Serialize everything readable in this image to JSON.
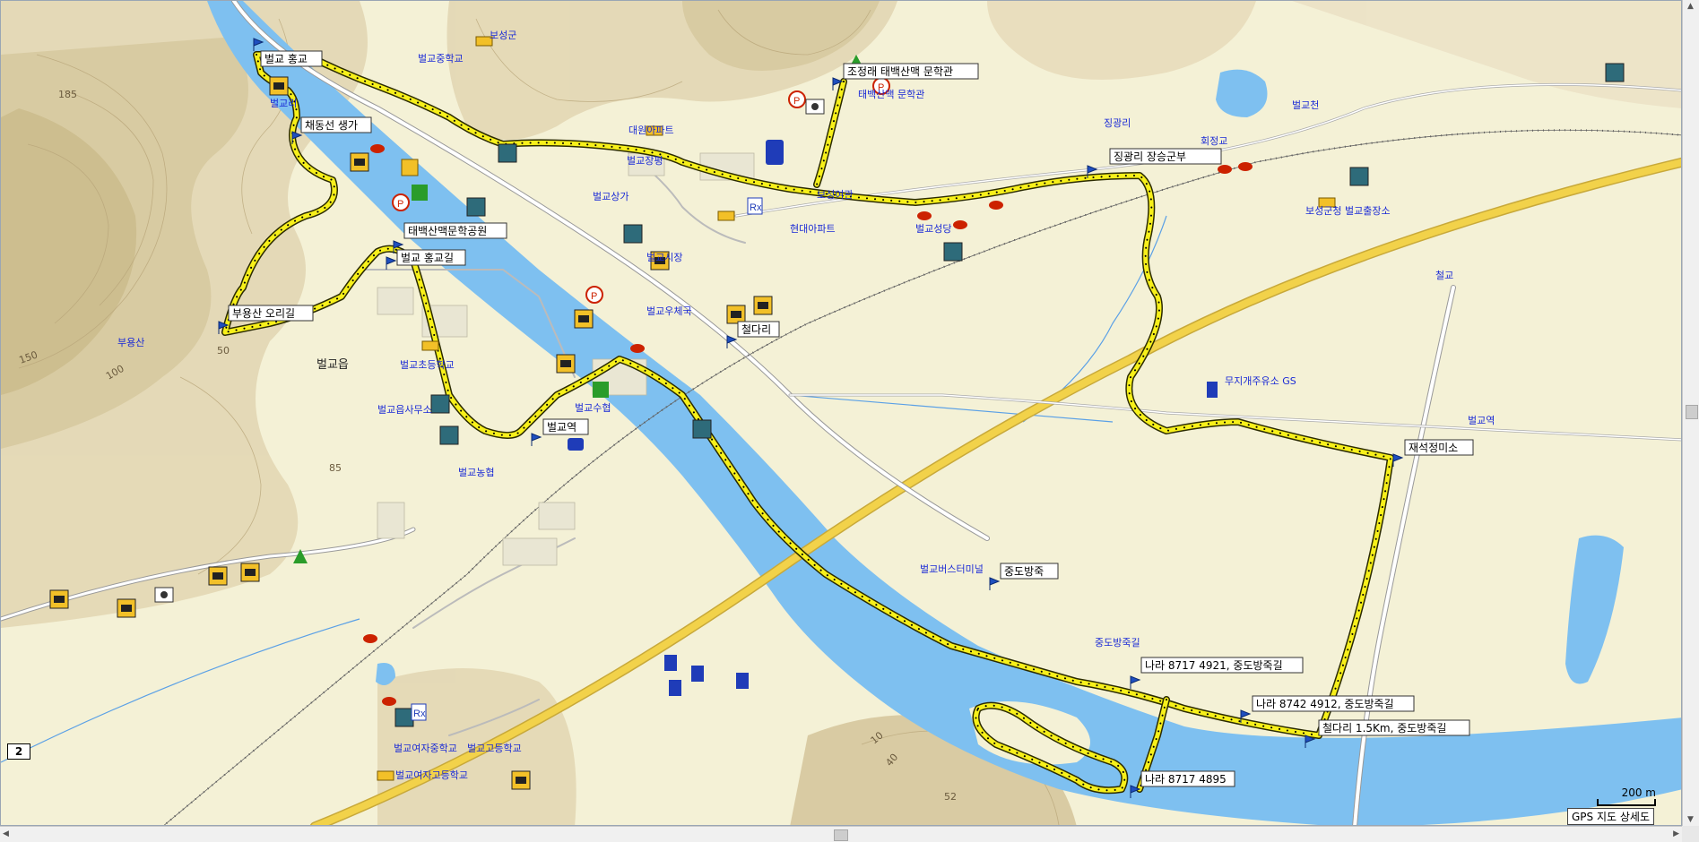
{
  "map": {
    "town_name": "벌교읍",
    "scale_label": "200 m",
    "source_label": "GPS 지도 상세도",
    "route_number": "2",
    "colors": {
      "land": "#f4f1d6",
      "hill": "#e3d7b4",
      "water": "#7ec0f0",
      "road": "#f2d24a",
      "track": "#f7f01a",
      "rail": "#555555",
      "label": "#1a2ad6"
    },
    "waypoints": [
      "벌교 홍교",
      "조정래 태백산맥 문학관",
      "채동선 생가",
      "태백산맥문학공원",
      "벌교 홍교길",
      "부용산 오리길",
      "철다리",
      "벌교역",
      "징광리 장승군부",
      "재석정미소",
      "중도방죽",
      "나라 8717 4921, 중도방죽길",
      "나라 8742 4912, 중도방죽길",
      "철다리 1.5Km, 중도방죽길",
      "나라 8717 4895"
    ],
    "labels": [
      "벌교중학교",
      "벌교리",
      "보성군",
      "벌교초등학교",
      "벌교고등학교",
      "벌교여자고등학교",
      "벌교여자중학교",
      "징광리",
      "벌교상가",
      "벌교시장",
      "벌교우체국",
      "벌교수협",
      "무지개주유소 GS",
      "회정교",
      "벌교농협",
      "벌교장평",
      "대원아파트",
      "벌교성당",
      "보성군청 벌교출장소",
      "보성여관",
      "현대아파트",
      "벌교천",
      "철교",
      "중도방죽길",
      "태백산맥 문학관",
      "벌교읍사무소",
      "부용산",
      "벌교버스터미널",
      "벌교역"
    ],
    "contours": [
      "185",
      "150",
      "100",
      "50",
      "85",
      "10",
      "40",
      "52"
    ]
  }
}
